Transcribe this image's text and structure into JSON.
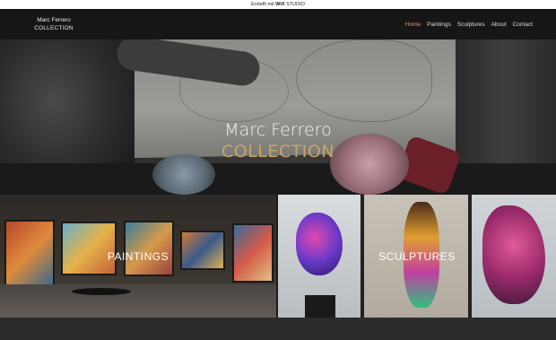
{
  "wix_bar": {
    "prefix": "Erstellt mit",
    "brand": "WiX",
    "suffix": "STUDIO"
  },
  "logo": {
    "line1": "Marc Ferrero",
    "line2": "COLLECTION"
  },
  "nav": [
    {
      "label": "Home",
      "active": true
    },
    {
      "label": "Paintings",
      "active": false
    },
    {
      "label": "Sculptures",
      "active": false
    },
    {
      "label": "About",
      "active": false
    },
    {
      "label": "Contact",
      "active": false
    }
  ],
  "hero": {
    "title": "Marc Ferrero",
    "subtitle": "COLLECTION"
  },
  "panels": {
    "paintings": "PAINTINGS",
    "sculptures": "SCULPTURES"
  },
  "colors": {
    "accent_gold": "#c8a46b",
    "header_bg": "#141414",
    "page_bg": "#1c1c1c"
  }
}
